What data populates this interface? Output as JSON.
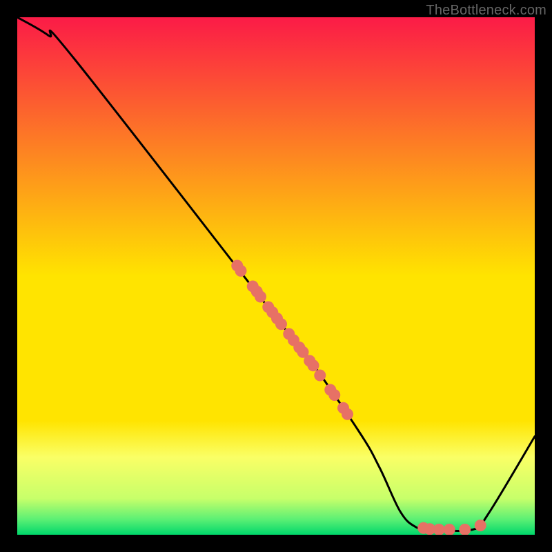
{
  "attribution": "TheBottleneck.com",
  "colors": {
    "top": "#fb1b47",
    "mid": "#ffe400",
    "low_yellow": "#faff66",
    "bottom": "#00d76b",
    "curve": "#000000",
    "dot_fill": "#e77165",
    "dot_stroke": "#d85b4f",
    "axis": "#000000",
    "page_bg": "#000000"
  },
  "chart_data": {
    "type": "line",
    "title": "",
    "xlabel": "",
    "ylabel": "",
    "xlim": [
      0,
      100
    ],
    "ylim": [
      0,
      100
    ],
    "grid": false,
    "legend": false,
    "curve": [
      {
        "x": 0,
        "y": 100
      },
      {
        "x": 6,
        "y": 96.5
      },
      {
        "x": 11,
        "y": 92
      },
      {
        "x": 50,
        "y": 42
      },
      {
        "x": 55,
        "y": 36
      },
      {
        "x": 66,
        "y": 20
      },
      {
        "x": 70,
        "y": 13
      },
      {
        "x": 74,
        "y": 4.5
      },
      {
        "x": 77,
        "y": 1.5
      },
      {
        "x": 80,
        "y": 1.0
      },
      {
        "x": 88,
        "y": 1.0
      },
      {
        "x": 91,
        "y": 4
      },
      {
        "x": 100,
        "y": 19
      }
    ],
    "scatter": [
      {
        "x": 42.5,
        "y": 52.0
      },
      {
        "x": 43.2,
        "y": 51.0
      },
      {
        "x": 45.5,
        "y": 48.0
      },
      {
        "x": 46.3,
        "y": 47.0
      },
      {
        "x": 47.0,
        "y": 46.0
      },
      {
        "x": 48.5,
        "y": 44.0
      },
      {
        "x": 49.3,
        "y": 43.0
      },
      {
        "x": 50.2,
        "y": 41.8
      },
      {
        "x": 51.0,
        "y": 40.7
      },
      {
        "x": 52.5,
        "y": 38.8
      },
      {
        "x": 53.4,
        "y": 37.6
      },
      {
        "x": 54.5,
        "y": 36.2
      },
      {
        "x": 55.2,
        "y": 35.3
      },
      {
        "x": 56.5,
        "y": 33.6
      },
      {
        "x": 57.2,
        "y": 32.7
      },
      {
        "x": 58.5,
        "y": 30.8
      },
      {
        "x": 60.5,
        "y": 28.0
      },
      {
        "x": 61.3,
        "y": 27.0
      },
      {
        "x": 63.0,
        "y": 24.5
      },
      {
        "x": 63.8,
        "y": 23.3
      },
      {
        "x": 78.5,
        "y": 1.3
      },
      {
        "x": 79.7,
        "y": 1.1
      },
      {
        "x": 81.5,
        "y": 1.0
      },
      {
        "x": 83.5,
        "y": 1.0
      },
      {
        "x": 86.5,
        "y": 1.0
      },
      {
        "x": 89.5,
        "y": 1.8
      }
    ],
    "gradient_bands": [
      {
        "y": 0,
        "color": "#fb1b47"
      },
      {
        "y": 50,
        "color": "#ffe400"
      },
      {
        "y": 78,
        "color": "#ffe400"
      },
      {
        "y": 85,
        "color": "#faff66"
      },
      {
        "y": 93,
        "color": "#c7ff6a"
      },
      {
        "y": 97,
        "color": "#5cf074"
      },
      {
        "y": 100,
        "color": "#00d76b"
      }
    ]
  }
}
